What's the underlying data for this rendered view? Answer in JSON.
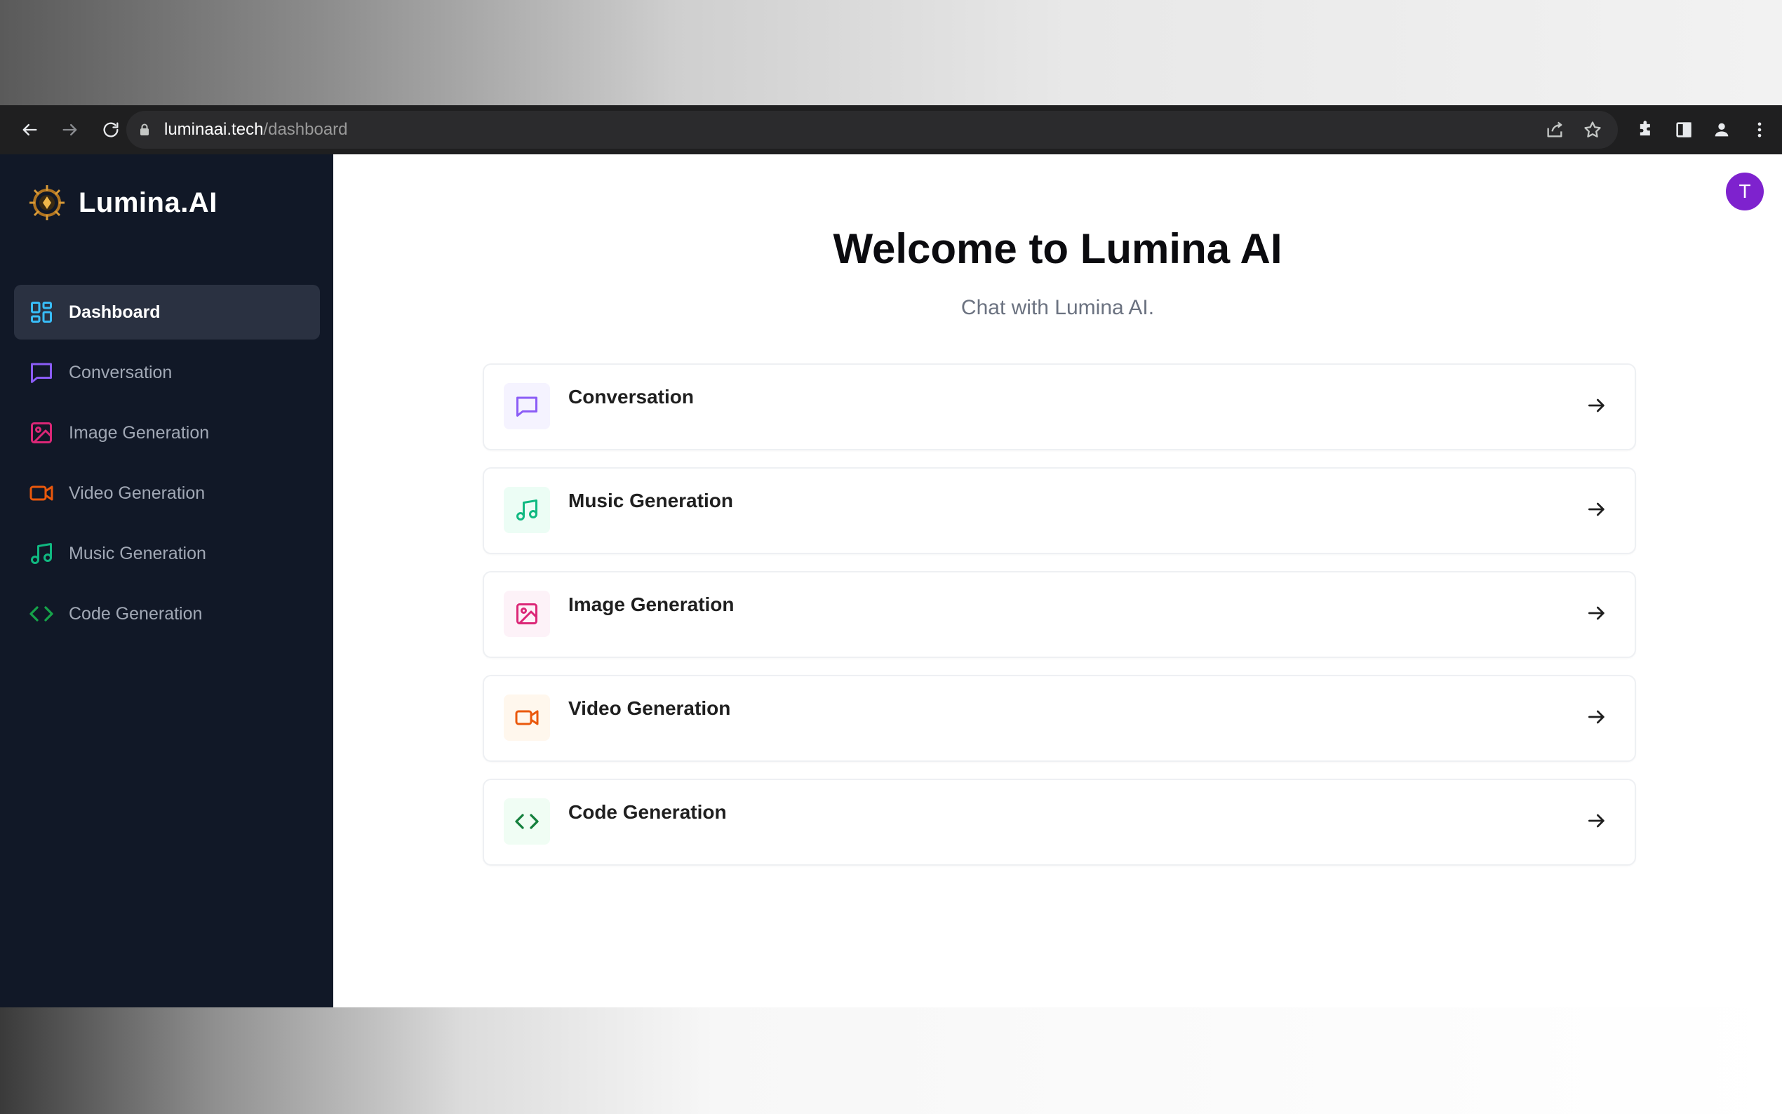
{
  "browser": {
    "url_host": "luminaai.tech",
    "url_path": "/dashboard"
  },
  "sidebar": {
    "brand": "Lumina.AI",
    "items": [
      {
        "label": "Dashboard",
        "icon": "dashboard-grid-icon",
        "color": "#38bdf8",
        "active": true
      },
      {
        "label": "Conversation",
        "icon": "chat-bubble-icon",
        "color": "#8b5cf6"
      },
      {
        "label": "Image Generation",
        "icon": "image-icon",
        "color": "#db2777"
      },
      {
        "label": "Video Generation",
        "icon": "video-camera-icon",
        "color": "#ea580c"
      },
      {
        "label": "Music Generation",
        "icon": "music-note-icon",
        "color": "#10b981"
      },
      {
        "label": "Code Generation",
        "icon": "code-brackets-icon",
        "color": "#16a34a"
      }
    ]
  },
  "header": {
    "avatar_initial": "T"
  },
  "main": {
    "title": "Welcome to Lumina AI",
    "subtitle": "Chat with Lumina AI.",
    "cards": [
      {
        "label": "Conversation",
        "icon": "chat-bubble-icon",
        "color": "#8b5cf6",
        "bg": "#f5f3ff"
      },
      {
        "label": "Music Generation",
        "icon": "music-note-icon",
        "color": "#10b981",
        "bg": "#ecfdf5"
      },
      {
        "label": "Image Generation",
        "icon": "image-icon",
        "color": "#db2777",
        "bg": "#fdf2f8"
      },
      {
        "label": "Video Generation",
        "icon": "video-camera-icon",
        "color": "#ea580c",
        "bg": "#fff7ed"
      },
      {
        "label": "Code Generation",
        "icon": "code-brackets-icon",
        "color": "#15803d",
        "bg": "#f0fdf4"
      }
    ]
  }
}
